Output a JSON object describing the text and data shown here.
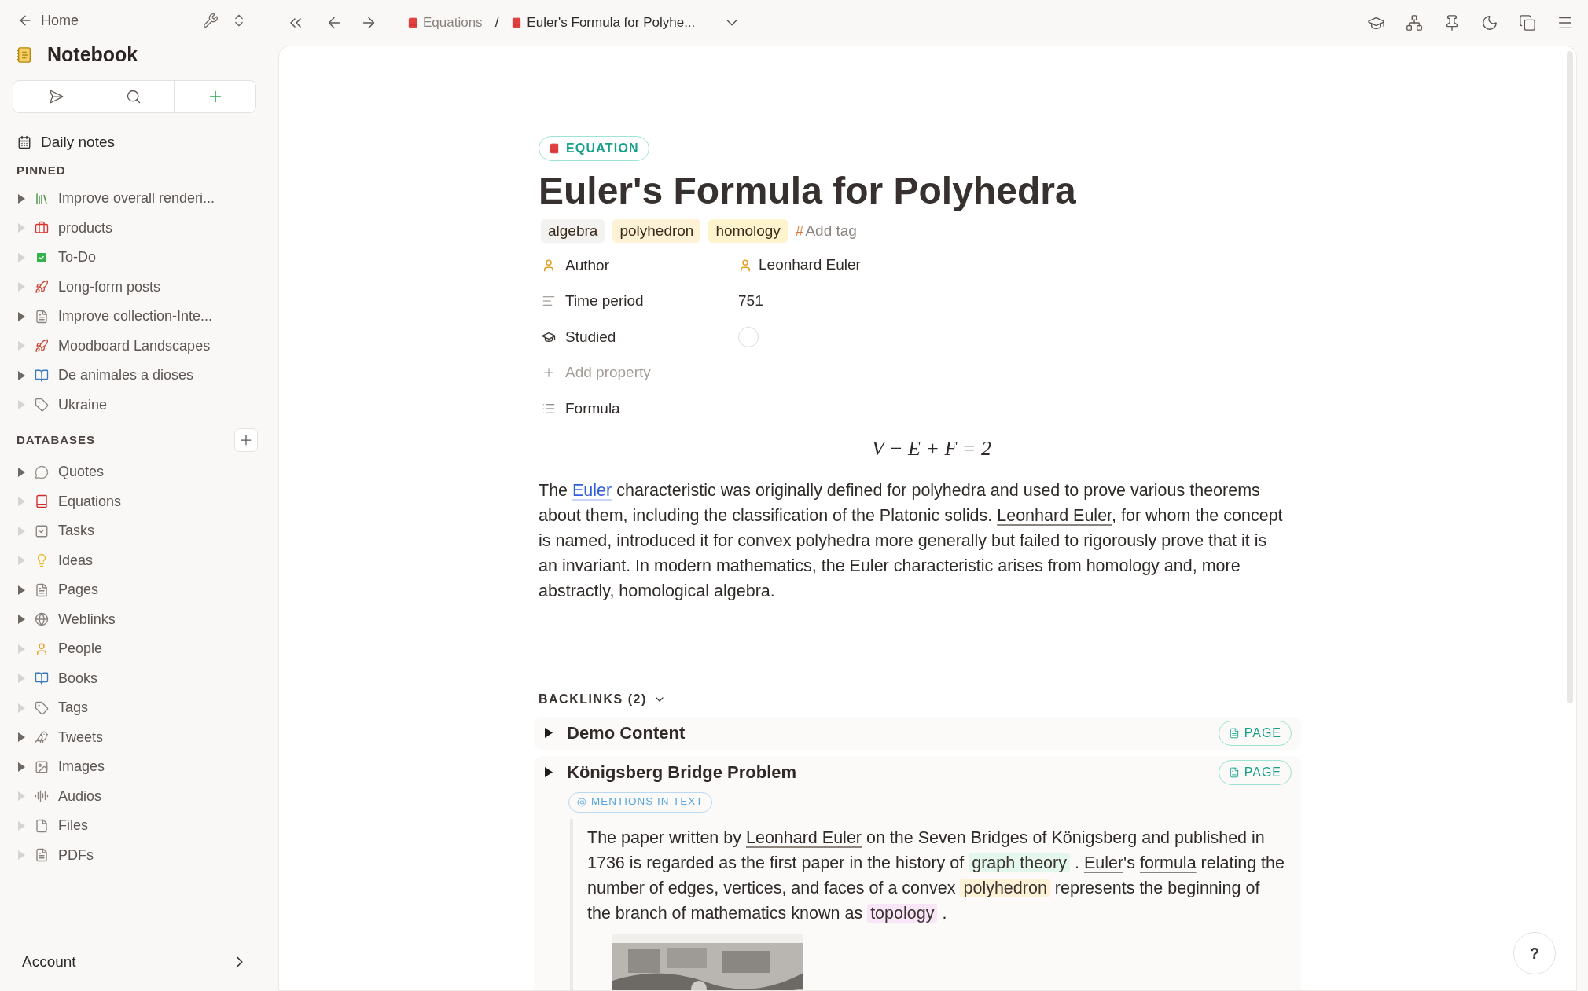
{
  "sidebar": {
    "back_label": "Home",
    "workspace": "Notebook",
    "daily_notes": "Daily notes",
    "pinned_heading": "PINNED",
    "pinned": [
      {
        "label": "Improve overall renderi...",
        "expandable": true
      },
      {
        "label": "products",
        "expandable": false
      },
      {
        "label": "To-Do",
        "expandable": false
      },
      {
        "label": "Long-form posts",
        "expandable": false
      },
      {
        "label": "Improve collection-Inte...",
        "expandable": true
      },
      {
        "label": "Moodboard Landscapes",
        "expandable": false
      },
      {
        "label": "De animales a dioses",
        "expandable": true
      },
      {
        "label": "Ukraine",
        "expandable": false
      }
    ],
    "databases_heading": "DATABASES",
    "databases": [
      {
        "label": "Quotes",
        "expandable": true
      },
      {
        "label": "Equations",
        "expandable": false
      },
      {
        "label": "Tasks",
        "expandable": false
      },
      {
        "label": "Ideas",
        "expandable": false
      },
      {
        "label": "Pages",
        "expandable": true
      },
      {
        "label": "Weblinks",
        "expandable": true
      },
      {
        "label": "People",
        "expandable": false
      },
      {
        "label": "Books",
        "expandable": false
      },
      {
        "label": "Tags",
        "expandable": false
      },
      {
        "label": "Tweets",
        "expandable": true
      },
      {
        "label": "Images",
        "expandable": true
      },
      {
        "label": "Audios",
        "expandable": false
      },
      {
        "label": "Files",
        "expandable": false
      },
      {
        "label": "PDFs",
        "expandable": false
      }
    ],
    "account": "Account"
  },
  "toolbar": {
    "breadcrumbs": [
      {
        "label": "Equations"
      },
      {
        "label": "Euler's Formula for Polyhe..."
      }
    ],
    "separator": "/"
  },
  "page": {
    "type_badge": "EQUATION",
    "title": "Euler's Formula for Polyhedra",
    "tags": [
      {
        "label": "algebra",
        "color": "#f3f2f0"
      },
      {
        "label": "polyhedron",
        "color": "#fdf1d6"
      },
      {
        "label": "homology",
        "color": "#fdf3cc"
      }
    ],
    "add_tag_symbol": "#",
    "add_tag": "Add tag",
    "properties": [
      {
        "kind": "person",
        "label": "Author",
        "value": "Leonhard Euler"
      },
      {
        "kind": "text",
        "label": "Time period",
        "value": "751"
      },
      {
        "kind": "checkbox",
        "label": "Studied",
        "checked": false
      },
      {
        "kind": "add",
        "label": "Add property"
      },
      {
        "kind": "formula",
        "label": "Formula"
      }
    ],
    "formula": "V − E + F = 2",
    "paragraph": [
      {
        "kind": "text",
        "text": "The "
      },
      {
        "kind": "link",
        "text": "Euler"
      },
      {
        "kind": "text",
        "text": " characteristic was originally defined for polyhedra and used to prove various theorems about them, including the classification of the Platonic solids. "
      },
      {
        "kind": "ref",
        "text": "Leonhard Euler"
      },
      {
        "kind": "text",
        "text": ", for whom the concept is named, introduced it for convex polyhedra more generally but failed to rigorously prove that it is an invariant. In modern mathematics, the Euler characteristic arises from homology and, more abstractly, homological algebra."
      }
    ]
  },
  "backlinks": {
    "heading": "BACKLINKS (2)",
    "items": [
      {
        "title": "Demo Content",
        "badge": "PAGE"
      },
      {
        "title": "Königsberg Bridge Problem",
        "badge": "PAGE",
        "mention_label": "MENTIONS IN TEXT",
        "segments": [
          {
            "kind": "text",
            "text": "The paper written by "
          },
          {
            "kind": "ref",
            "text": "Leonhard Euler"
          },
          {
            "kind": "text",
            "text": " on the Seven Bridges of Königsberg and published in 1736 is regarded as the first paper in the history of "
          },
          {
            "kind": "tag",
            "text": "graph theory",
            "color": "#e3f7ec"
          },
          {
            "kind": "text",
            "text": " . "
          },
          {
            "kind": "ref",
            "text": "Euler"
          },
          {
            "kind": "text",
            "text": "'s "
          },
          {
            "kind": "ref",
            "text": "formula"
          },
          {
            "kind": "text",
            "text": " relating the number of edges, vertices, and faces of a convex "
          },
          {
            "kind": "tag",
            "text": "polyhedron",
            "color": "#fdf1d6"
          },
          {
            "kind": "text",
            "text": " represents the beginning of the branch of mathematics known as "
          },
          {
            "kind": "tag",
            "text": "topology",
            "color": "#f8e6f8"
          },
          {
            "kind": "text",
            "text": " ."
          }
        ],
        "picture": {
          "kind": "picture"
        }
      }
    ]
  },
  "help": "?"
}
